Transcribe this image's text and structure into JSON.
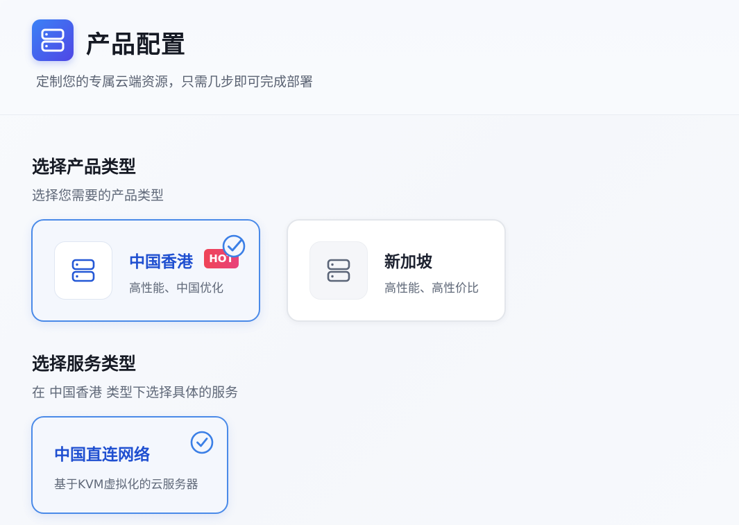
{
  "header": {
    "title": "产品配置",
    "subtitle": "定制您的专属云端资源，只需几步即可完成部署",
    "icon": "server-icon",
    "accent": "#3b82f6"
  },
  "product_section": {
    "title": "选择产品类型",
    "desc": "选择您需要的产品类型",
    "options": [
      {
        "name": "中国香港",
        "desc": "高性能、中国优化",
        "badge": "HOT",
        "selected": true,
        "icon": "server-icon"
      },
      {
        "name": "新加坡",
        "desc": "高性能、高性价比",
        "badge": "",
        "selected": false,
        "icon": "server-icon"
      }
    ]
  },
  "service_section": {
    "title": "选择服务类型",
    "desc": "在 中国香港 类型下选择具体的服务",
    "options": [
      {
        "name": "中国直连网络",
        "desc": "基于KVM虚拟化的云服务器",
        "selected": true
      }
    ]
  },
  "colors": {
    "selected_border": "#4a8ae8",
    "selected_text": "#1f4fd0",
    "hot_badge": "#ef4456"
  }
}
